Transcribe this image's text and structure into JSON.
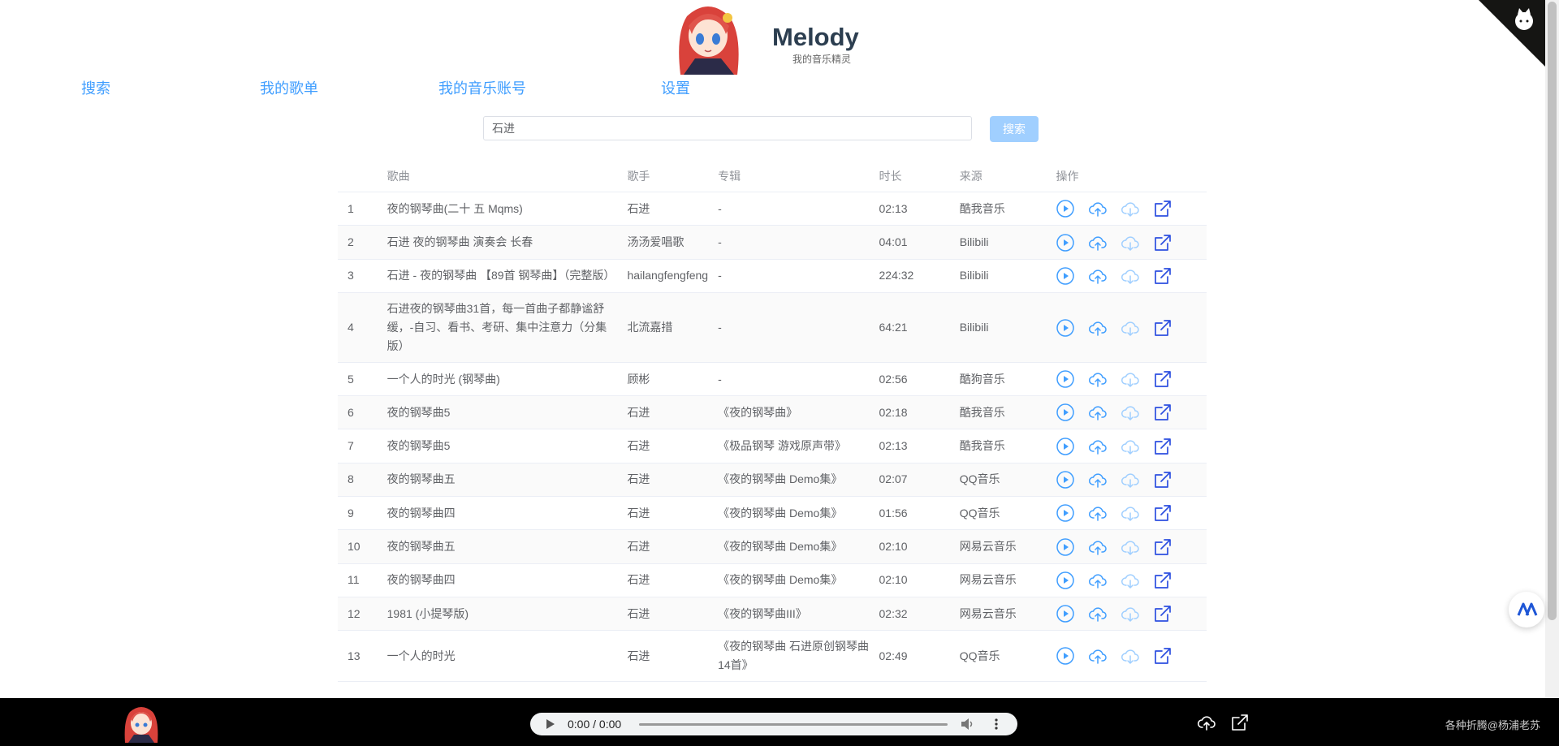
{
  "brand": {
    "title": "Melody",
    "subtitle": "我的音乐精灵"
  },
  "nav": [
    {
      "label": "搜索"
    },
    {
      "label": "我的歌单"
    },
    {
      "label": "我的音乐账号"
    },
    {
      "label": "设置"
    }
  ],
  "search": {
    "value": "石进",
    "button_label": "搜索"
  },
  "table": {
    "headers": [
      "",
      "歌曲",
      "歌手",
      "专辑",
      "时长",
      "来源",
      "操作"
    ],
    "rows": [
      {
        "index": "1",
        "song": "夜的钢琴曲(二十 五 Mqms)",
        "artist": "石进",
        "album": "-",
        "duration": "02:13",
        "source": "酷我音乐"
      },
      {
        "index": "2",
        "song": "石进 夜的钢琴曲 演奏会 长春",
        "artist": "汤汤爱唱歌",
        "album": "-",
        "duration": "04:01",
        "source": "Bilibili"
      },
      {
        "index": "3",
        "song": "石进 - 夜的钢琴曲 【89首 钢琴曲】（完整版）",
        "artist": "hailangfengfeng",
        "album": "-",
        "duration": "224:32",
        "source": "Bilibili"
      },
      {
        "index": "4",
        "song": "石进夜的钢琴曲31首，每一首曲子都静谧舒缓，-自习、看书、考研、集中注意力（分集版）",
        "artist": "北流嘉措",
        "album": "-",
        "duration": "64:21",
        "source": "Bilibili"
      },
      {
        "index": "5",
        "song": "一个人的时光 (钢琴曲)",
        "artist": "顾彬",
        "album": "-",
        "duration": "02:56",
        "source": "酷狗音乐"
      },
      {
        "index": "6",
        "song": "夜的钢琴曲5",
        "artist": "石进",
        "album": "《夜的钢琴曲》",
        "duration": "02:18",
        "source": "酷我音乐"
      },
      {
        "index": "7",
        "song": "夜的钢琴曲5",
        "artist": "石进",
        "album": "《极品钢琴 游戏原声带》",
        "duration": "02:13",
        "source": "酷我音乐"
      },
      {
        "index": "8",
        "song": "夜的钢琴曲五",
        "artist": "石进",
        "album": "《夜的钢琴曲 Demo集》",
        "duration": "02:07",
        "source": "QQ音乐"
      },
      {
        "index": "9",
        "song": "夜的钢琴曲四",
        "artist": "石进",
        "album": "《夜的钢琴曲 Demo集》",
        "duration": "01:56",
        "source": "QQ音乐"
      },
      {
        "index": "10",
        "song": "夜的钢琴曲五",
        "artist": "石进",
        "album": "《夜的钢琴曲 Demo集》",
        "duration": "02:10",
        "source": "网易云音乐"
      },
      {
        "index": "11",
        "song": "夜的钢琴曲四",
        "artist": "石进",
        "album": "《夜的钢琴曲 Demo集》",
        "duration": "02:10",
        "source": "网易云音乐"
      },
      {
        "index": "12",
        "song": "1981 (小提琴版)",
        "artist": "石进",
        "album": "《夜的钢琴曲III》",
        "duration": "02:32",
        "source": "网易云音乐"
      },
      {
        "index": "13",
        "song": "一个人的时光",
        "artist": "石进",
        "album": "《夜的钢琴曲 石进原创钢琴曲14首》",
        "duration": "02:49",
        "source": "QQ音乐"
      }
    ]
  },
  "player": {
    "time": "0:00 / 0:00"
  },
  "footer": {
    "credit": "各种折腾@杨浦老苏"
  },
  "colors": {
    "accent": "#409eff",
    "button_disabled": "#a0cfff",
    "footer_bg": "#000000"
  },
  "icons": [
    "play-circle-icon",
    "upload-cloud-icon",
    "download-cloud-icon",
    "external-link-icon",
    "github-icon"
  ]
}
